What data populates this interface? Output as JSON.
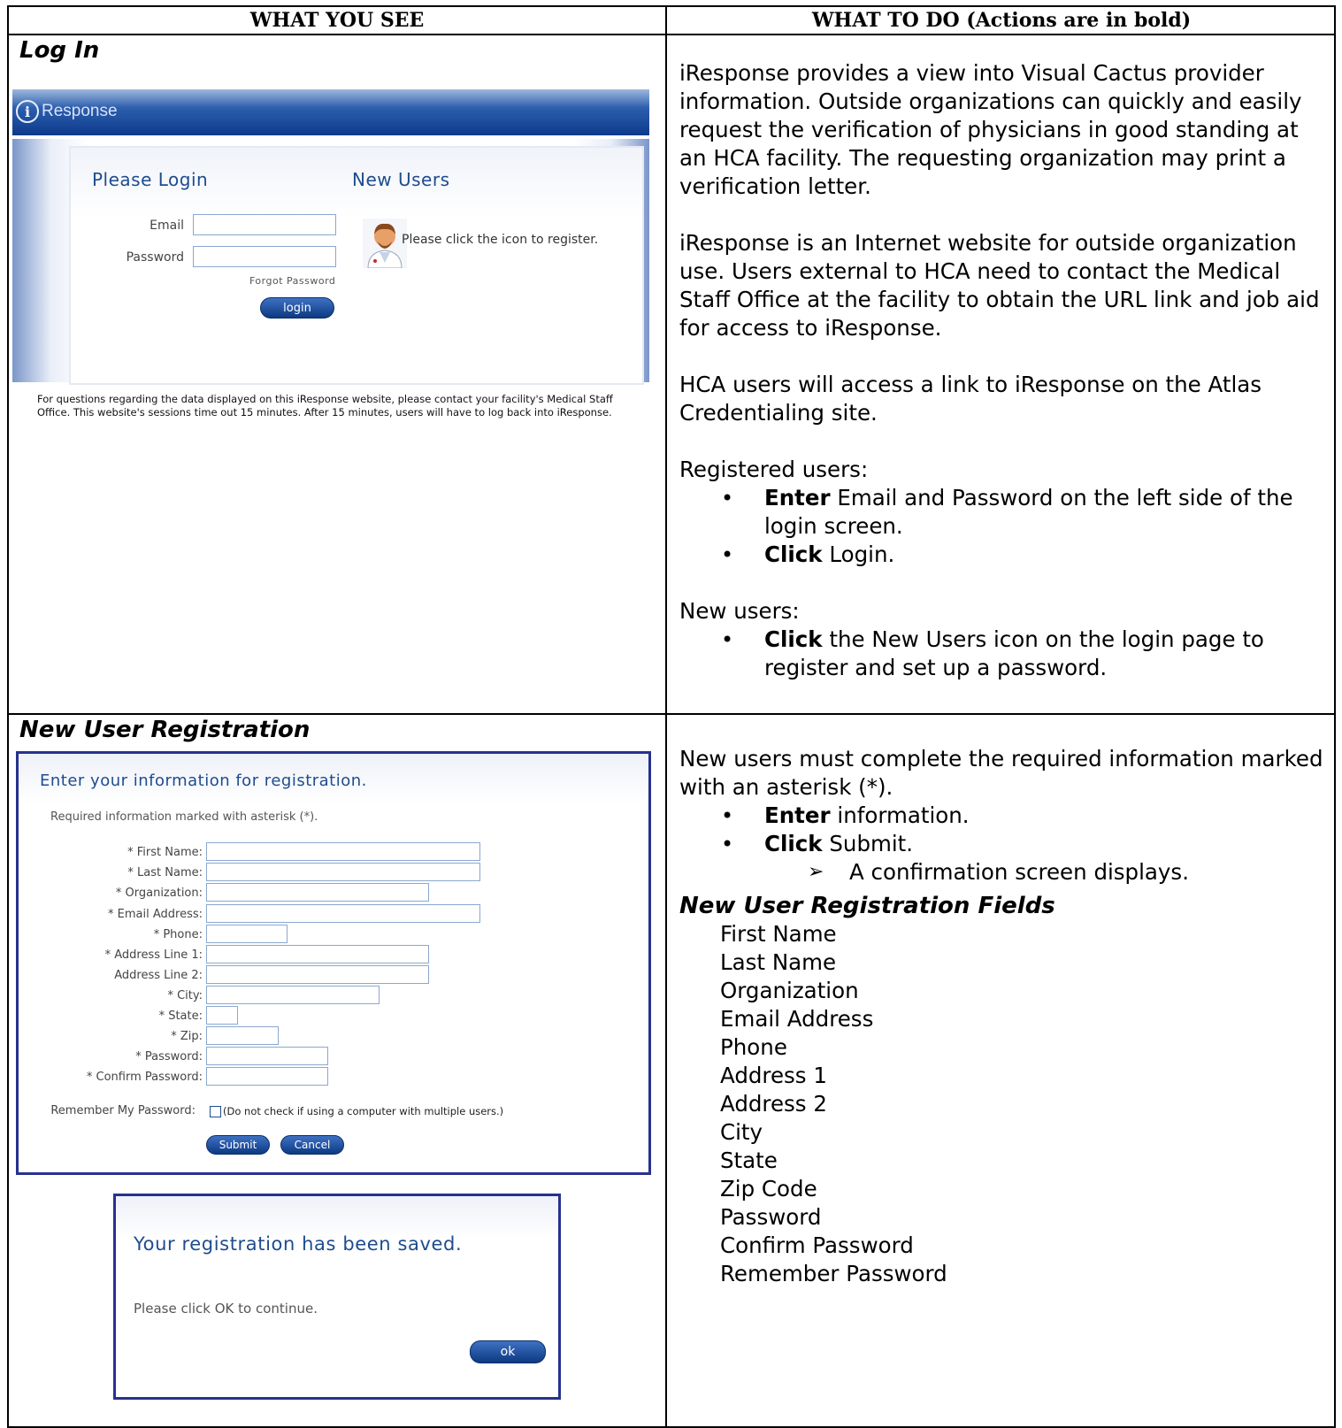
{
  "table": {
    "col_left_header": "WHAT YOU SEE",
    "col_right_header": "WHAT TO DO (Actions are in bold)"
  },
  "login_section": {
    "title": "Log In",
    "screenshot": {
      "logo_text": "Response",
      "please_login": "Please Login",
      "new_users": "New Users",
      "email_label": "Email",
      "password_label": "Password",
      "forgot_password": "Forgot Password",
      "login_button": "login",
      "register_note": "Please click the icon to register.",
      "footer": "For questions regarding the data displayed on this iResponse website, please contact your facility's Medical Staff Office. This website's sessions time out 15 minutes. After 15 minutes, users will have to log back into iResponse."
    },
    "instructions": {
      "p1": "iResponse provides a view into Visual Cactus provider information.  Outside organizations can quickly and easily request the verification of physicians in good standing at an HCA facility. The requesting organization may print a verification letter.",
      "p2": "iResponse is an Internet website for outside organization use.  Users external to HCA need to contact the Medical Staff Office at the facility to obtain the URL link and job aid for access to iResponse.",
      "p3": "HCA users will access a link to iResponse on the Atlas Credentialing site.",
      "registered_heading": "Registered users:",
      "reg_b1_action": "Enter",
      "reg_b1_text": " Email and Password on the left side of the login screen.",
      "reg_b2_action": "Click",
      "reg_b2_text": " Login.",
      "new_heading": "New users:",
      "new_b1_action": "Click",
      "new_b1_text": " the New Users icon on the login page to register and set up a password."
    }
  },
  "registration_section": {
    "title": "New User Registration",
    "form": {
      "heading": "Enter your information for registration.",
      "required_note": "Required information marked with asterisk (*).",
      "fields": [
        {
          "label": "* First Name:"
        },
        {
          "label": "* Last Name:"
        },
        {
          "label": "* Organization:"
        },
        {
          "label": "* Email Address:"
        },
        {
          "label": "* Phone:"
        },
        {
          "label": "* Address Line 1:"
        },
        {
          "label": "Address Line 2:"
        },
        {
          "label": "* City:"
        },
        {
          "label": "* State:"
        },
        {
          "label": "* Zip:"
        },
        {
          "label": "* Password:"
        },
        {
          "label": "* Confirm Password:"
        }
      ],
      "remember_label": "Remember My Password:",
      "remember_note": "(Do not check if using a computer with multiple users.)",
      "submit_button": "Submit",
      "cancel_button": "Cancel"
    },
    "confirmation": {
      "title": "Your registration has been saved.",
      "subtitle": "Please click OK to continue.",
      "ok_button": "ok"
    },
    "instructions": {
      "p1": "New users must complete the required information marked with an asterisk (*).",
      "b1_action": "Enter",
      "b1_text": " information.",
      "b2_action": "Click",
      "b2_text": " Submit.",
      "sub_b1": "A confirmation screen displays.",
      "fields_heading": "New User Registration Fields",
      "field_list": [
        "First Name",
        "Last Name",
        "Organization",
        "Email Address",
        "Phone",
        "Address 1",
        "Address 2",
        "City",
        "State",
        "Zip Code",
        "Password",
        "Confirm Password",
        "Remember Password"
      ]
    }
  }
}
